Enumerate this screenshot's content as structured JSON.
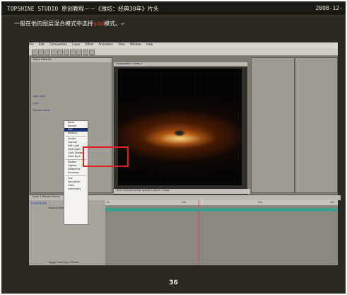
{
  "header": {
    "title": "TOPSHINE STUDIO 原创教程－－《潍坊：经典30年》片头",
    "date": "2008-12-"
  },
  "instruction": {
    "before": "一般在他的图层混合模式中选择",
    "keyword": "add",
    "after": "模式。",
    "mark": "↵"
  },
  "app": {
    "menu": [
      "File",
      "Edit",
      "Composition",
      "Layer",
      "Effect",
      "Animation",
      "View",
      "Window",
      "Help"
    ],
    "effect_controls": {
      "title": "Effect Controls",
      "rows": [
        {
          "label": "Light Color",
          "value": ""
        },
        {
          "label": "Color",
          "value": ""
        },
        {
          "label": "Transfer Mode",
          "value": ""
        }
      ]
    },
    "composition_title": "Composition: Comp 1",
    "comp_footer": "50%    0:00:00:04    Full    Active Camera    1 View",
    "transfer_modes": [
      "None",
      "Normal",
      "Add",
      "Multiply",
      "Screen",
      "Overlay",
      "Soft Light",
      "Hard Light",
      "Color Dodge",
      "Color Burn",
      "Darken",
      "Lighten",
      "Difference",
      "Exclusion",
      "Hue",
      "Saturation",
      "Color",
      "Luminosity"
    ],
    "selected_mode": "Add",
    "timeline": {
      "tabs": "Comp 1    Render Queue",
      "timecode": "0:00:00:04",
      "source_col": "Source Name",
      "ticks": [
        "0s",
        "10s",
        "20s",
        "30s"
      ],
      "footer": "Toggle Switches / Modes"
    }
  },
  "page_number": "36"
}
